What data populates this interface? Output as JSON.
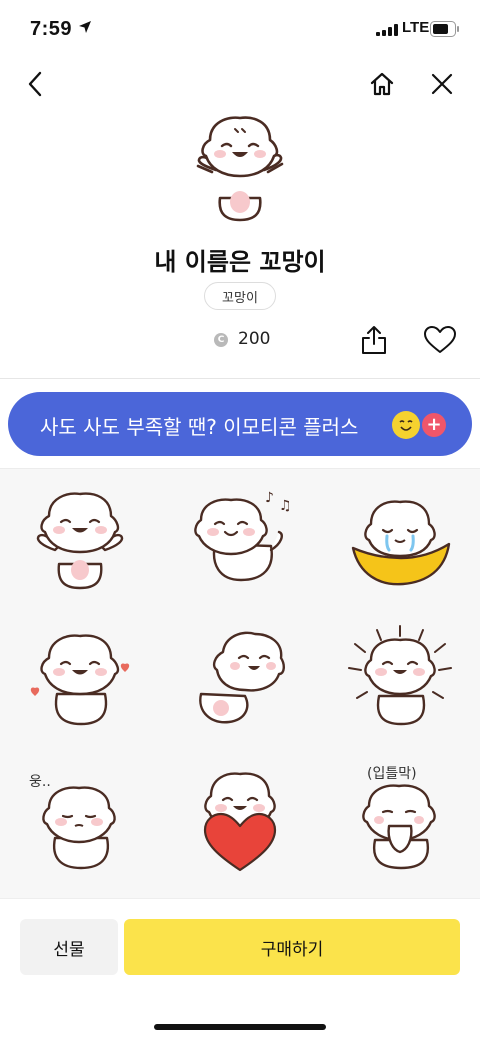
{
  "status_bar": {
    "time": "7:59",
    "network": "LTE"
  },
  "nav": {
    "back_icon": "chevron-left-icon",
    "home_icon": "home-icon",
    "close_icon": "close-icon"
  },
  "product": {
    "title": "내 이름은 꼬망이",
    "author": "꼬망이",
    "coin_symbol": "C",
    "price": "200"
  },
  "banner": {
    "text": "사도 사도 부족할 땐? 이모티콘 플러스",
    "plus_symbol": "+",
    "background": "#4b66d9"
  },
  "stickers": {
    "captions": [
      "웅..",
      "(입틀막)"
    ]
  },
  "actions": {
    "gift_label": "선물",
    "buy_label": "구매하기",
    "buy_color": "#fbe34b"
  }
}
